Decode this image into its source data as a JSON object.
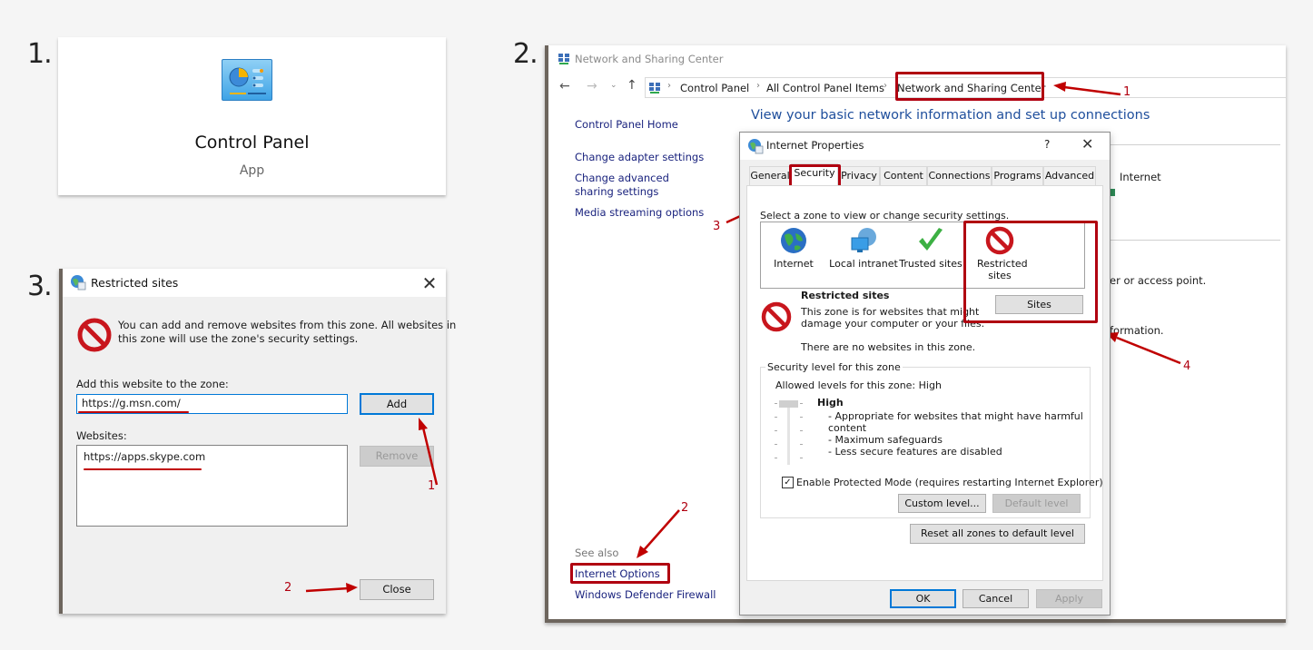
{
  "steps": {
    "step1": "1.",
    "step2": "2.",
    "step3": "3."
  },
  "panel1": {
    "icon": "control-panel-icon",
    "title": "Control Panel",
    "subtitle": "App"
  },
  "panel3": {
    "window_title": "Restricted sites",
    "icon": "restricted-no-entry-icon",
    "description_line1": "You can add and remove websites from this zone. All websites in",
    "description_line2": "this zone will use the zone's security settings.",
    "add_label": "Add this website to the zone:",
    "add_input_value": "https://g.msn.com/",
    "add_button": "Add",
    "websites_label": "Websites:",
    "websites": [
      "https://apps.skype.com"
    ],
    "remove_button": "Remove",
    "close_button": "Close",
    "annotations": [
      "1",
      "2"
    ]
  },
  "panel2": {
    "window_title": "Network and Sharing Center",
    "breadcrumb": [
      "Control Panel",
      "All Control Panel Items",
      "Network and Sharing Center"
    ],
    "sidebar": {
      "home": "Control Panel Home",
      "links": [
        "Change adapter settings",
        "Change advanced sharing settings",
        "Media streaming options"
      ],
      "see_also_label": "See also",
      "see_also": [
        "Internet Options",
        "Windows Defender Firewall"
      ]
    },
    "main_heading": "View your basic network information and set up connections",
    "bg_texts": {
      "internet": "Internet",
      "access_point": "er or access point.",
      "information": "formation."
    },
    "annotations": [
      "1",
      "2",
      "3",
      "4"
    ]
  },
  "internet_properties": {
    "title": "Internet Properties",
    "help": "?",
    "tabs": [
      "General",
      "Security",
      "Privacy",
      "Content",
      "Connections",
      "Programs",
      "Advanced"
    ],
    "active_tab": "Security",
    "select_zone_label": "Select a zone to view or change security settings.",
    "zones": [
      {
        "name": "Internet",
        "icon": "globe-icon"
      },
      {
        "name": "Local intranet",
        "icon": "intranet-globe-monitor-icon"
      },
      {
        "name": "Trusted sites",
        "icon": "green-checkmark-icon"
      },
      {
        "name": "Restricted sites",
        "icon": "restricted-no-entry-icon"
      }
    ],
    "selected_zone": "Restricted sites",
    "sites_button": "Sites",
    "zone_title": "Restricted sites",
    "zone_desc_line1": "This zone is for websites that might",
    "zone_desc_line2": "damage your computer or your files.",
    "zone_empty": "There are no websites in this zone.",
    "security_group_label": "Security level for this zone",
    "allowed_levels": "Allowed levels for this zone: High",
    "level_name": "High",
    "level_details": [
      "- Appropriate for websites that might have harmful",
      "content",
      "- Maximum safeguards",
      "- Less secure features are disabled"
    ],
    "slider_level": "High (top of 5 levels)",
    "protected_mode_label": "Enable Protected Mode (requires restarting Internet Explorer)",
    "protected_mode_checked": true,
    "custom_level_button": "Custom level...",
    "default_level_button": "Default level",
    "reset_button": "Reset all zones to default level",
    "ok_button": "OK",
    "cancel_button": "Cancel",
    "apply_button": "Apply"
  },
  "colors": {
    "annotation_red": "#b00010",
    "link_blue": "#1a237e",
    "heading_blue": "#1e4e9c",
    "focus_blue": "#0078d7"
  }
}
